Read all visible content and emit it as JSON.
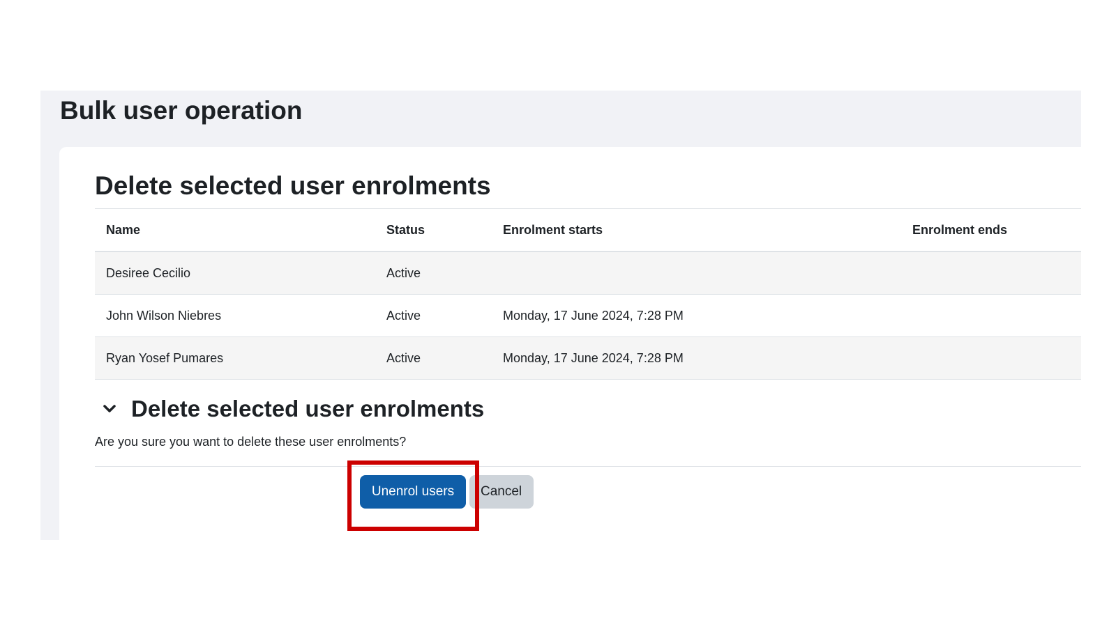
{
  "page": {
    "title": "Bulk user operation"
  },
  "section": {
    "title": "Delete selected user enrolments"
  },
  "table": {
    "headers": [
      "Name",
      "Status",
      "Enrolment starts",
      "Enrolment ends"
    ],
    "rows": [
      [
        "Desiree Cecilio",
        "Active",
        "",
        ""
      ],
      [
        "John Wilson Niebres",
        "Active",
        "Monday, 17 June 2024, 7:28 PM",
        ""
      ],
      [
        "Ryan Yosef Pumares",
        "Active",
        "Monday, 17 June 2024, 7:28 PM",
        ""
      ]
    ]
  },
  "confirm": {
    "title": "Delete selected user enrolments",
    "icon": "chevron-down-icon",
    "message": "Are you sure you want to delete these user enrolments?",
    "unenrol_label": "Unenrol users",
    "cancel_label": "Cancel"
  },
  "colors": {
    "page_background": "#f1f2f6",
    "primary_button": "#0f5ea8",
    "secondary_button": "#ced4da",
    "highlight": "#cc0000"
  }
}
